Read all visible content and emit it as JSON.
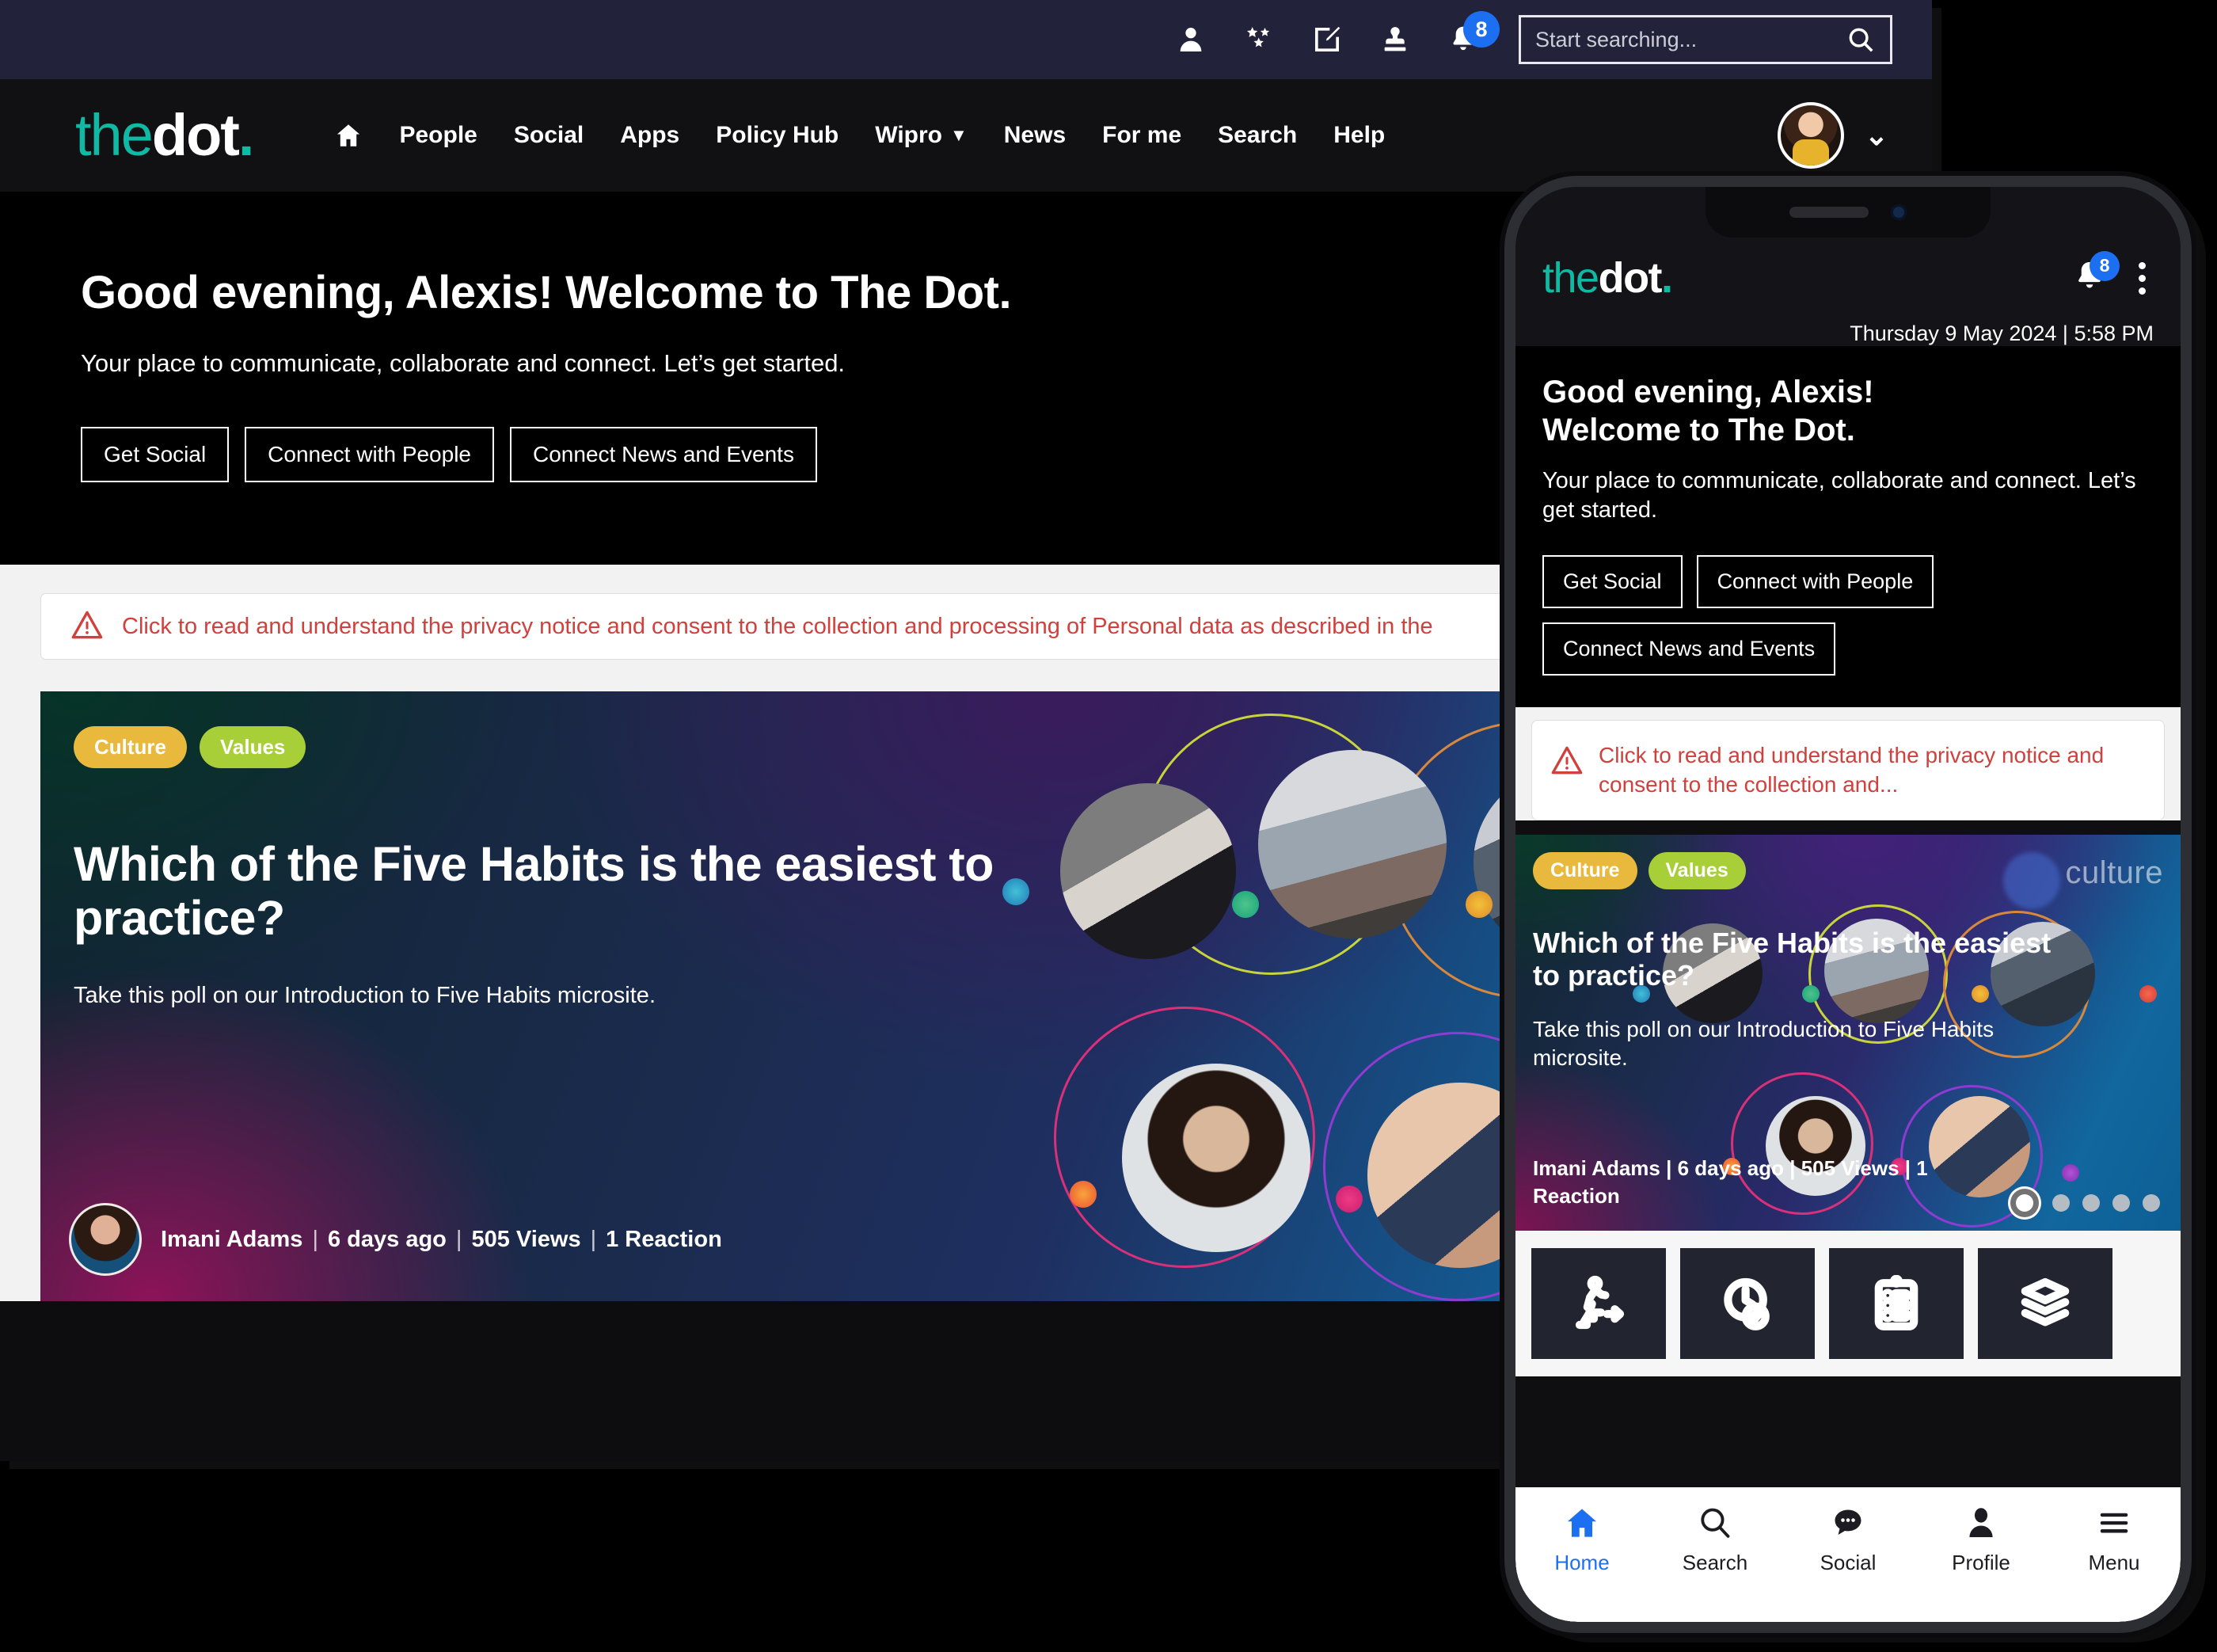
{
  "brand": {
    "logo_part1": "the",
    "logo_part2": "dot",
    "logo_part3": ".",
    "accent_teal": "#0fb9a3",
    "accent_blue": "#1d6ff2",
    "alert_red": "#d0403c"
  },
  "desktop": {
    "utility_bar": {
      "icons": [
        {
          "name": "person-icon",
          "label": "Person"
        },
        {
          "name": "stars-icon",
          "label": "Recognition"
        },
        {
          "name": "compose-icon",
          "label": "Compose"
        },
        {
          "name": "stamp-icon",
          "label": "Approvals"
        }
      ],
      "notifications": {
        "name": "bell-icon",
        "badge": "8"
      },
      "search": {
        "placeholder": "Start searching...",
        "value": ""
      }
    },
    "nav": {
      "home_label": "Home",
      "items": [
        {
          "label": "People",
          "has_caret": false
        },
        {
          "label": "Social",
          "has_caret": false
        },
        {
          "label": "Apps",
          "has_caret": false
        },
        {
          "label": "Policy Hub",
          "has_caret": false
        },
        {
          "label": "Wipro",
          "has_caret": true
        },
        {
          "label": "News",
          "has_caret": false
        },
        {
          "label": "For me",
          "has_caret": false
        },
        {
          "label": "Search",
          "has_caret": false
        },
        {
          "label": "Help",
          "has_caret": false
        }
      ],
      "profile_caret": "⌄"
    },
    "hero": {
      "title": "Good evening, Alexis! Welcome to The Dot.",
      "subtitle": "Your place to communicate, collaborate and connect. Let’s get started.",
      "buttons": [
        "Get Social",
        "Connect with People",
        "Connect News and Events"
      ]
    },
    "privacy_notice": "Click to read and understand the privacy notice and consent to the collection and processing of Personal data as described in the",
    "story": {
      "tags": [
        {
          "label": "Culture",
          "color": "#e8b93c"
        },
        {
          "label": "Values",
          "color": "#a8cf38"
        }
      ],
      "headline": "Which of the Five Habits is the easiest to practice?",
      "body": "Take this poll on our Introduction to Five Habits microsite.",
      "author": "Imani Adams",
      "time": "6 days ago",
      "views": "505 Views",
      "reactions": "1 Reaction",
      "separator": "|"
    }
  },
  "phone": {
    "logo_part1": "the",
    "logo_part2": "dot",
    "logo_part3": ".",
    "notifications": {
      "name": "bell-icon",
      "badge": "8"
    },
    "menu_icon": "kebab-menu-icon",
    "datetime": "Thursday 9 May 2024 | 5:58 PM",
    "hero": {
      "title_line1": "Good evening, Alexis!",
      "title_line2": "Welcome to The Dot.",
      "subtitle": "Your place to communicate, collaborate and connect. Let’s get started.",
      "buttons": [
        "Get Social",
        "Connect with People",
        "Connect News and Events"
      ]
    },
    "privacy_notice": "Click to read and understand the privacy notice and consent to the collection and...",
    "story": {
      "tags": [
        {
          "label": "Culture",
          "color": "#e8b93c"
        },
        {
          "label": "Values",
          "color": "#a8cf38"
        }
      ],
      "headline": "Which of the Five Habits is the easiest to practice?",
      "body": "Take this poll on our Introduction to Five Habits microsite.",
      "byline": "Imani Adams  |  6 days ago  |  505 Views  |  1 Reaction",
      "watermark": "culture",
      "carousel": {
        "total": 5,
        "active_index": 1
      }
    },
    "tiles": [
      {
        "name": "onboarding-stairs-icon"
      },
      {
        "name": "clock-check-icon"
      },
      {
        "name": "clipboard-list-icon"
      },
      {
        "name": "documents-icon"
      }
    ],
    "bottom_nav": [
      {
        "label": "Home",
        "icon": "home-icon",
        "active": true
      },
      {
        "label": "Search",
        "icon": "search-icon",
        "active": false
      },
      {
        "label": "Social",
        "icon": "chat-bubble-icon",
        "active": false
      },
      {
        "label": "Profile",
        "icon": "person-icon",
        "active": false
      },
      {
        "label": "Menu",
        "icon": "hamburger-icon",
        "active": false
      }
    ]
  }
}
